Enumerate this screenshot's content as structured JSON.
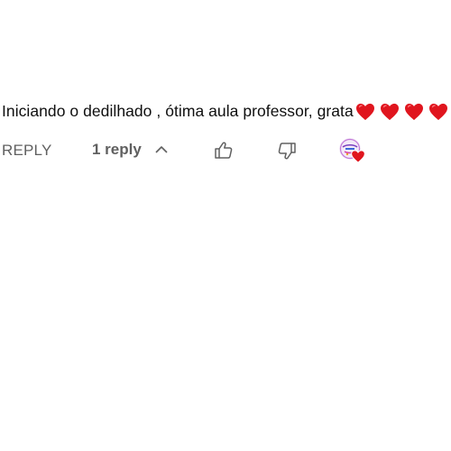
{
  "comment": {
    "text": "Iniciando o dedilhado , ótima aula professor, grata",
    "emoji": [
      "red-heart",
      "red-heart",
      "red-heart",
      "red-heart"
    ]
  },
  "actions": {
    "reply_label": "REPLY",
    "replies_label": "1 reply",
    "chevron_icon": "chevron-up-icon",
    "like_icon": "thumb-up-icon",
    "dislike_icon": "thumb-down-icon",
    "creator_heart_icon": "creator-heart-icon"
  },
  "colors": {
    "text": "#0f0f0f",
    "secondary": "#606060",
    "heart": "#e0151e"
  }
}
